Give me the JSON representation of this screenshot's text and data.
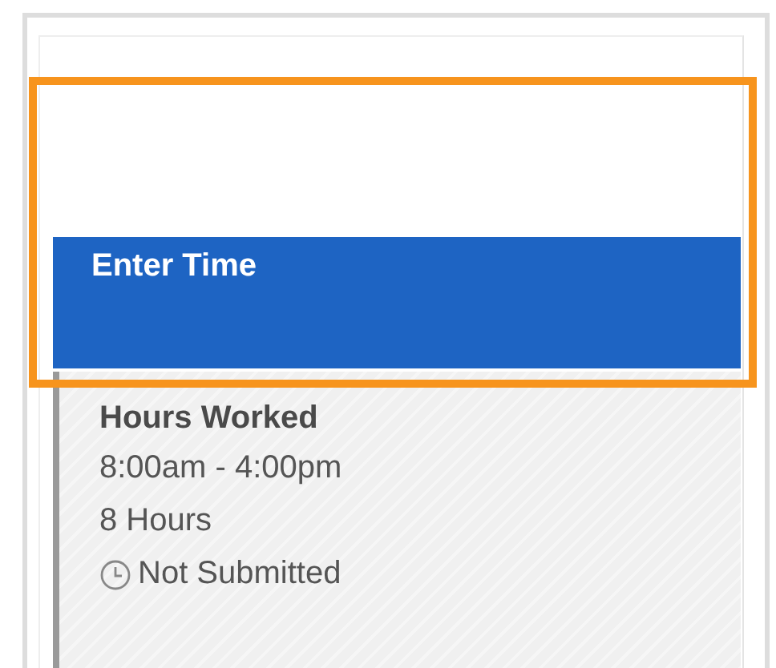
{
  "header": {
    "title": "Enter Time",
    "highlighted": true
  },
  "entry": {
    "title": "Hours Worked",
    "time_range": "8:00am - 4:00pm",
    "duration": "8 Hours",
    "status": "Not Submitted"
  }
}
